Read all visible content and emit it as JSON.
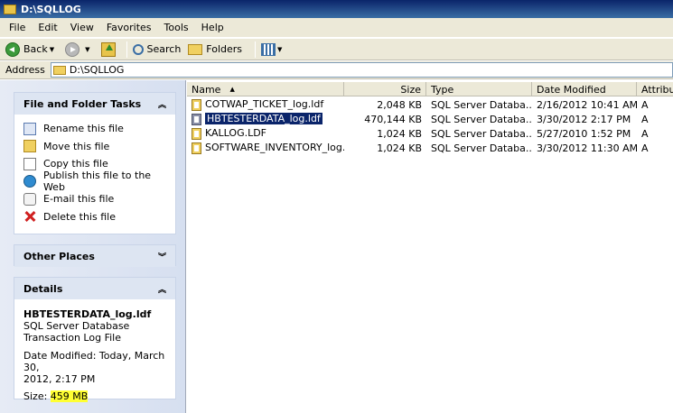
{
  "window": {
    "title": "D:\\SQLLOG"
  },
  "menu": [
    {
      "label": "File"
    },
    {
      "label": "Edit"
    },
    {
      "label": "View"
    },
    {
      "label": "Favorites"
    },
    {
      "label": "Tools"
    },
    {
      "label": "Help"
    }
  ],
  "toolbar": {
    "back_label": "Back",
    "search_label": "Search",
    "folders_label": "Folders"
  },
  "address": {
    "label": "Address",
    "value": "D:\\SQLLOG"
  },
  "tasks": {
    "title": "File and Folder Tasks",
    "items": [
      {
        "label": "Rename this file",
        "icon": "rename-icon"
      },
      {
        "label": "Move this file",
        "icon": "move-icon"
      },
      {
        "label": "Copy this file",
        "icon": "copy-icon"
      },
      {
        "label": "Publish this file to the Web",
        "icon": "globe-icon"
      },
      {
        "label": "E-mail this file",
        "icon": "mail-icon"
      },
      {
        "label": "Delete this file",
        "icon": "delete-icon"
      }
    ]
  },
  "other_places": {
    "title": "Other Places"
  },
  "details": {
    "title": "Details",
    "filename": "HBTESTERDATA_log.ldf",
    "type_line1": "SQL Server Database",
    "type_line2": "Transaction Log File",
    "modified_line1": "Date Modified: Today, March 30,",
    "modified_line2": "2012, 2:17 PM",
    "size_label": "Size:",
    "size_value": "459 MB",
    "highlight_color": "#ffff33"
  },
  "columns": [
    {
      "label": "Name"
    },
    {
      "label": "Size"
    },
    {
      "label": "Type"
    },
    {
      "label": "Date Modified"
    },
    {
      "label": "Attributes"
    }
  ],
  "files": [
    {
      "name": "COTWAP_TICKET_log.ldf",
      "size": "2,048 KB",
      "type": "SQL Server Databa...",
      "modified": "2/16/2012 10:41 AM",
      "attr": "A",
      "selected": false
    },
    {
      "name": "HBTESTERDATA_log.ldf",
      "size": "470,144 KB",
      "type": "SQL Server Databa...",
      "modified": "3/30/2012 2:17 PM",
      "attr": "A",
      "selected": true
    },
    {
      "name": "KALLOG.LDF",
      "size": "1,024 KB",
      "type": "SQL Server Databa...",
      "modified": "5/27/2010 1:52 PM",
      "attr": "A",
      "selected": false
    },
    {
      "name": "SOFTWARE_INVENTORY_log.ldf",
      "size": "1,024 KB",
      "type": "SQL Server Databa...",
      "modified": "3/30/2012 11:30 AM",
      "attr": "A",
      "selected": false
    }
  ]
}
